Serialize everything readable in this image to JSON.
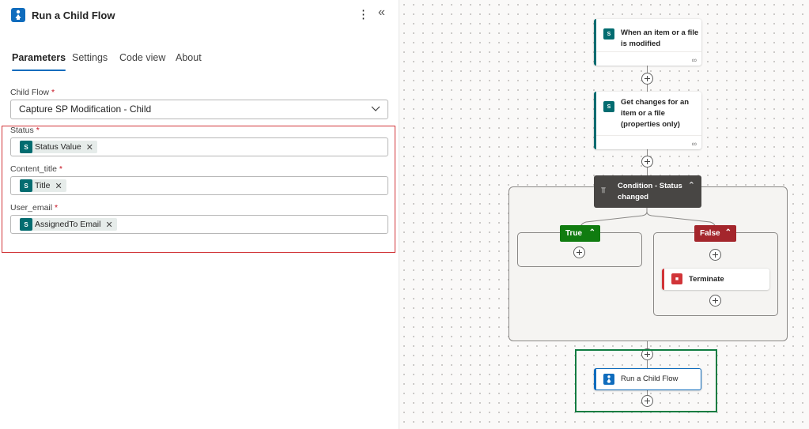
{
  "panel": {
    "title": "Run a Child Flow",
    "tabs": [
      "Parameters",
      "Settings",
      "Code view",
      "About"
    ],
    "active_tab": "Parameters",
    "fields": {
      "child_flow": {
        "label": "Child Flow",
        "required_mark": "*",
        "value": "Capture SP Modification - Child"
      },
      "status": {
        "label": "Status",
        "required_mark": "*",
        "token": "Status Value"
      },
      "content_title": {
        "label": "Content_title",
        "required_mark": "*",
        "token": "Title"
      },
      "user_email": {
        "label": "User_email",
        "required_mark": "*",
        "token": "AssignedTo Email"
      }
    },
    "token_remove_glyph": "✕",
    "more_icon": "more-vertical-icon",
    "collapse_icon": "double-chevron-left-icon"
  },
  "flow": {
    "trigger": {
      "label": "When an item or a file is modified",
      "line1": "When an item or a file",
      "line2": "is modified"
    },
    "get_changes": {
      "line1": "Get changes for an",
      "line2": "item or a file",
      "line3": "(properties only)"
    },
    "condition": {
      "line1": "Condition - Status",
      "line2": "changed"
    },
    "true_branch": {
      "label": "True"
    },
    "false_branch": {
      "label": "False"
    },
    "terminate": {
      "label": "Terminate"
    },
    "run_child": {
      "label": "Run a Child Flow"
    }
  },
  "colors": {
    "accent": "#0f6cbd",
    "sharepoint": "#036c70",
    "condition": "#484644",
    "true": "#107c10",
    "false": "#a4262c",
    "terminate": "#d13438",
    "highlight_red": "#d13438",
    "highlight_green": "#107c41"
  }
}
